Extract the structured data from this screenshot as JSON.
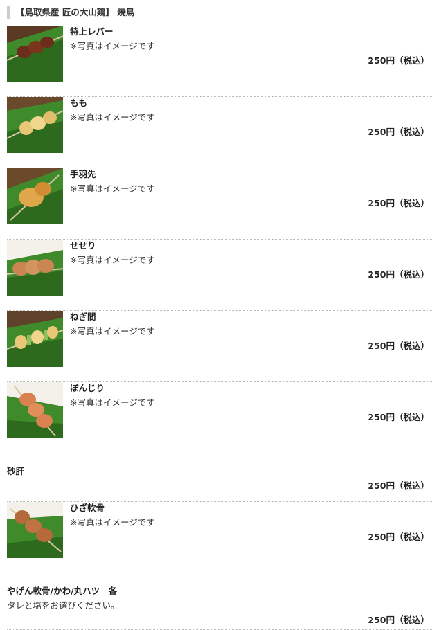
{
  "section": {
    "title": "【鳥取県産 匠の大山鶏】 焼鳥"
  },
  "items": [
    {
      "name": "特上レバー",
      "note": "※写真はイメージです",
      "price": "250円（税込）",
      "photo": "grilled-liver-skewer"
    },
    {
      "name": "もも",
      "note": "※写真はイメージです",
      "price": "250円（税込）",
      "photo": "grilled-thigh-skewer"
    },
    {
      "name": "手羽先",
      "note": "※写真はイメージです",
      "price": "250円（税込）",
      "photo": "grilled-wing-skewer"
    },
    {
      "name": "せせり",
      "note": "※写真はイメージです",
      "price": "250円（税込）",
      "photo": "grilled-neck-skewer"
    },
    {
      "name": "ねぎ間",
      "note": "※写真はイメージです",
      "price": "250円（税込）",
      "photo": "grilled-negima-skewer"
    },
    {
      "name": "ぼんじり",
      "note": "※写真はイメージです",
      "price": "250円（税込）",
      "photo": "grilled-tail-skewer"
    },
    {
      "name": "砂肝",
      "note": "",
      "price": "250円（税込）",
      "photo": ""
    },
    {
      "name": "ひざ軟骨",
      "note": "※写真はイメージです",
      "price": "250円（税込）",
      "photo": "grilled-cartilage-skewer"
    },
    {
      "name": "やげん軟骨/かわ/丸ハツ　各",
      "note": "タレと塩をお選びください。",
      "price": "250円（税込）",
      "photo": ""
    }
  ],
  "colors": {
    "leaf_green": "#3f8a2a",
    "leaf_dark": "#2d6a1e",
    "skewer_meat": "#c98552",
    "header_bar": "#cccccc"
  }
}
